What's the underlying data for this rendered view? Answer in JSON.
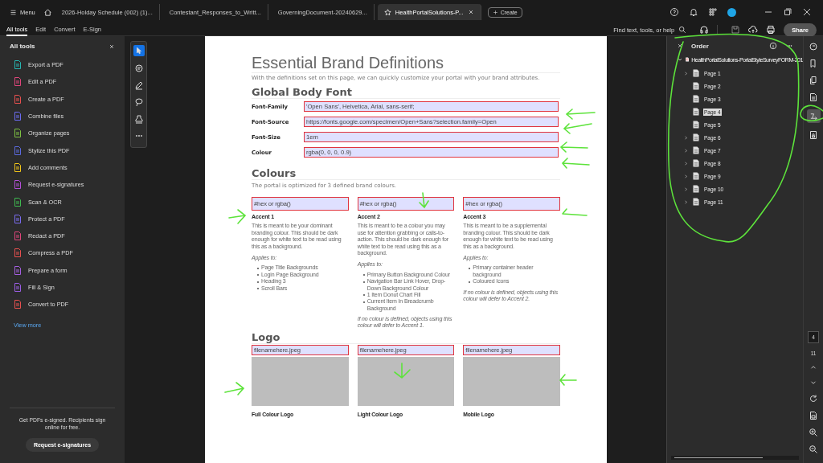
{
  "app_bar": {
    "menu": "Menu",
    "tabs": [
      {
        "label": "2026-Holday Schedule (002) (1)...",
        "selected": false
      },
      {
        "label": "Contestant_Responses_to_Writt...",
        "selected": false
      },
      {
        "label": "GoverningDocument-20240629...",
        "selected": false
      },
      {
        "label": "HealthPortalSolutions-P...",
        "selected": true
      }
    ],
    "create": "Create"
  },
  "toolbar": {
    "menus": [
      {
        "label": "All tools",
        "selected": true
      },
      {
        "label": "Edit",
        "selected": false
      },
      {
        "label": "Convert",
        "selected": false
      },
      {
        "label": "E-Sign",
        "selected": false
      }
    ],
    "search": "Find text, tools, or help",
    "share": "Share"
  },
  "tools_panel": {
    "title": "All tools",
    "items": [
      {
        "label": "Export a PDF",
        "color": "#26b5b0"
      },
      {
        "label": "Edit a PDF",
        "color": "#e0457b"
      },
      {
        "label": "Create a PDF",
        "color": "#e8504f"
      },
      {
        "label": "Combine files",
        "color": "#6b6bf0"
      },
      {
        "label": "Organize pages",
        "color": "#7ec242"
      },
      {
        "label": "Stylize this PDF",
        "color": "#5b6ae0"
      },
      {
        "label": "Add comments",
        "color": "#f0c419"
      },
      {
        "label": "Request e-signatures",
        "color": "#b44fd8"
      },
      {
        "label": "Scan & OCR",
        "color": "#3fb950"
      },
      {
        "label": "Protect a PDF",
        "color": "#7a6cf0"
      },
      {
        "label": "Redact a PDF",
        "color": "#e0457b"
      },
      {
        "label": "Compress a PDF",
        "color": "#e8504f"
      },
      {
        "label": "Prepare a form",
        "color": "#a45ee0"
      },
      {
        "label": "Fill & Sign",
        "color": "#9b5de5"
      },
      {
        "label": "Convert to PDF",
        "color": "#e8504f"
      }
    ],
    "view_more": "View more",
    "promo": "Get PDFs e-signed. Recipients sign online for free.",
    "promo_button": "Request e-signatures"
  },
  "document": {
    "title": "Essential Brand Definitions",
    "intro": "With the definitions set on this page, we can quickly customize your portal with your brand attributes.",
    "font_section": {
      "heading": "Global Body Font",
      "fields": [
        {
          "label": "Font-Family",
          "value": "'Open Sans', Helvetica, Arial, sans-serif;"
        },
        {
          "label": "Font-Source",
          "value": "https://fonts.google.com/specimen/Open+Sans?selection.family=Open"
        },
        {
          "label": "Font-Size",
          "value": "1em"
        },
        {
          "label": "Colour",
          "value": "rgba(0, 0, 0, 0.9)"
        }
      ]
    },
    "colours_section": {
      "heading": "Colours",
      "intro": "The portal is optimized for 3 defined brand colours.",
      "accents": [
        {
          "value": "#hex or rgba()",
          "name": "Accent 1",
          "description": "This is meant to be your dominant branding colour. This should be dark enough for white text to be read using this as a background.",
          "applies_label": "Applies to:",
          "applies": [
            "Page Title Backgrounds",
            "Login Page Background",
            "Heading 3",
            "Scroll Bars"
          ]
        },
        {
          "value": "#hex or rgba()",
          "name": "Accent 2",
          "description": "This is meant to be a colour you may use for attention grabbing or calls-to-action. This should be dark enough for white text to be read using this as a background.",
          "applies_label": "Applies to:",
          "applies": [
            "Primary Button Background Colour",
            "Navigation Bar Link Hover, Drop-Down Background Colour",
            "1 Item Donut Chart Fill",
            "Current Item In Breadcrumb Background"
          ],
          "note": "If no colour is defined, objects using this colour will defer to Accent 1."
        },
        {
          "value": "#hex or rgba()",
          "name": "Accent 3",
          "description": "This is meant to be a supplemental branding colour. This should be dark enough for white text to be read using this as a background.",
          "applies_label": "Applies to:",
          "applies": [
            "Primary container header background",
            "Coloured Icons"
          ],
          "note": "If no colour is defined, objects using this colour will defer to Accent 2."
        }
      ]
    },
    "logo_section": {
      "heading": "Logo",
      "items": [
        {
          "value": "filenamehere.jpeg",
          "caption": "Full Colour Logo"
        },
        {
          "value": "filenamehere.jpeg",
          "caption": "Light Colour Logo"
        },
        {
          "value": "filenamehere.jpeg",
          "caption": "Mobile Logo"
        }
      ]
    }
  },
  "order_panel": {
    "title": "Order",
    "file": "HealthPortalSolutions-PortalStyleSurveyFORM-201",
    "pages": [
      {
        "label": "Page 1",
        "expandable": true,
        "selected": false
      },
      {
        "label": "Page 2",
        "expandable": false,
        "selected": false
      },
      {
        "label": "Page 3",
        "expandable": false,
        "selected": false
      },
      {
        "label": "Page 4",
        "expandable": false,
        "selected": true
      },
      {
        "label": "Page 5",
        "expandable": false,
        "selected": false
      },
      {
        "label": "Page 6",
        "expandable": true,
        "selected": false
      },
      {
        "label": "Page 7",
        "expandable": true,
        "selected": false
      },
      {
        "label": "Page 8",
        "expandable": true,
        "selected": false
      },
      {
        "label": "Page 9",
        "expandable": true,
        "selected": false
      },
      {
        "label": "Page 10",
        "expandable": true,
        "selected": false
      },
      {
        "label": "Page 11",
        "expandable": true,
        "selected": false
      }
    ]
  },
  "page_nav": {
    "current": "4",
    "total": "11"
  }
}
